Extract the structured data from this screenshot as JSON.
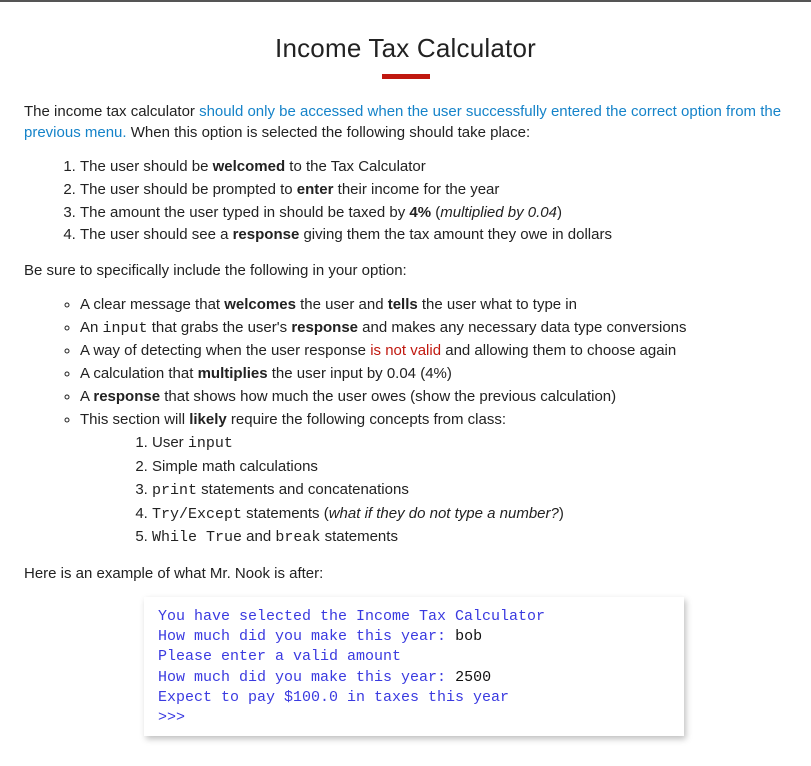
{
  "title": "Income Tax Calculator",
  "intro_before": "The income tax calculator ",
  "intro_highlight": "should only be accessed when the user successfully entered the correct option from the previous menu.",
  "intro_after": " When this option is selected the following should take place:",
  "steps": {
    "s1a": "The user should be ",
    "s1b": "welcomed",
    "s1c": " to the Tax Calculator",
    "s2a": "The user should be prompted to ",
    "s2b": "enter",
    "s2c": " their income for the year",
    "s3a": "The amount the user typed in should be taxed by ",
    "s3b": "4%",
    "s3c": " (",
    "s3d": "multiplied by 0.04",
    "s3e": ")",
    "s4a": "The user should see a ",
    "s4b": "response",
    "s4c": " giving them the tax amount they owe in dollars"
  },
  "include_label": "Be sure to specifically include the following in your option:",
  "bullets": {
    "b1a": "A clear message that ",
    "b1b": "welcomes",
    "b1c": " the user and ",
    "b1d": "tells",
    "b1e": " the user what to type in",
    "b2a": "An ",
    "b2b": "input",
    "b2c": " that grabs the user's ",
    "b2d": "response",
    "b2e": " and makes any necessary data type conversions",
    "b3a": "A way of detecting when the user response ",
    "b3b": "is not valid",
    "b3c": " and allowing them to choose again",
    "b4a": "A calculation that ",
    "b4b": "multiplies",
    "b4c": " the user input by 0.04 (4%)",
    "b5a": "A ",
    "b5b": "response",
    "b5c": " that shows how much the user owes (show the previous calculation)",
    "b6a": "This section will ",
    "b6b": "likely",
    "b6c": " require the following concepts from class:"
  },
  "sublist": {
    "c1a": "User ",
    "c1b": "input",
    "c2": "Simple math calculations",
    "c3a": "print",
    "c3b": " statements and concatenations",
    "c4a": "Try/Except",
    "c4b": " statements (",
    "c4c": "what if they do not type a number?",
    "c4d": ")",
    "c5a": "While True",
    "c5b": " and ",
    "c5c": "break",
    "c5d": " statements"
  },
  "example_label": "Here is an example of what Mr. Nook is after:",
  "example": {
    "l1": "You have selected the Income Tax Calculator",
    "l2a": "How much did you make this year: ",
    "l2b": "bob",
    "l3": "Please enter a valid amount",
    "l4a": "How much did you make this year: ",
    "l4b": "2500",
    "l5": "Expect to pay $100.0 in taxes this year",
    "l6": ">>>"
  }
}
